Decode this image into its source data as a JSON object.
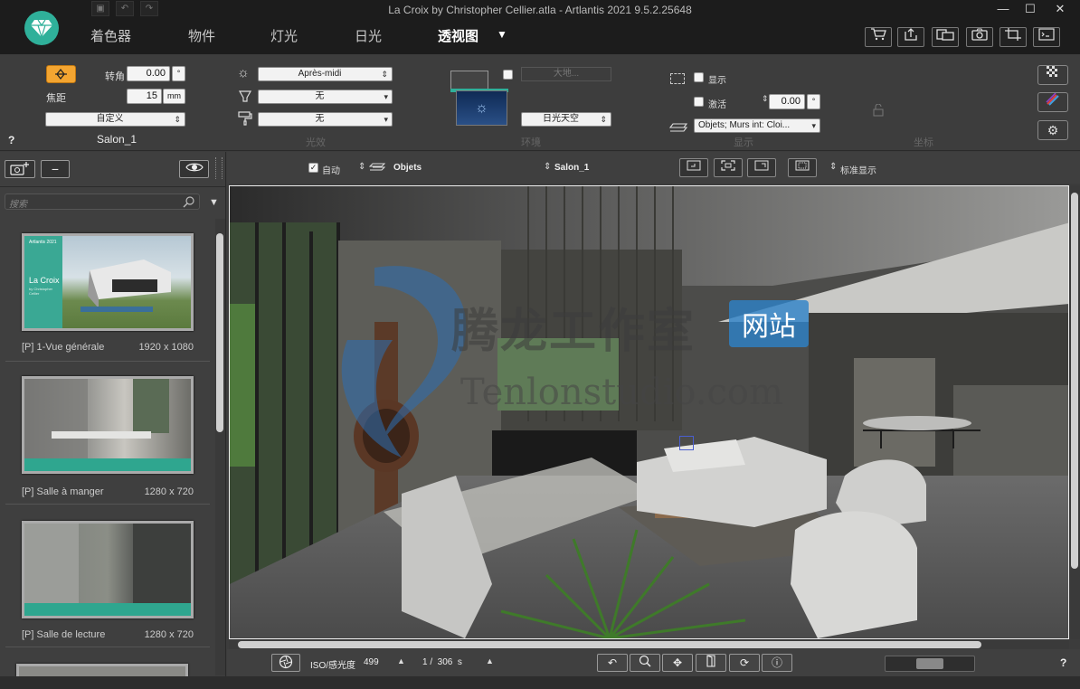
{
  "window": {
    "title": "La Croix by Christopher Cellier.atla - Artlantis 2021 9.5.2.25648",
    "minimize": "—",
    "maximize": "☐",
    "close": "✕"
  },
  "quick_access": {
    "save": "▣",
    "undo": "↶",
    "redo": "↷"
  },
  "nav": {
    "tabs": [
      "着色器",
      "物件",
      "灯光",
      "日光",
      "透视图"
    ],
    "active": "透视图",
    "dropdown_arrow": "▼"
  },
  "top_right_buttons": [
    "shopping-cart",
    "export",
    "window-layout",
    "camera",
    "crop",
    "console"
  ],
  "toolbar": {
    "camera": {
      "rotation_label": "转角",
      "rotation_value": "0.00",
      "rotation_unit": "°",
      "focal_label": "焦距",
      "focal_value": "15",
      "focal_unit": "mm",
      "preset_value": "自定义",
      "view_name": "Salon_1",
      "help": "?"
    },
    "lighting": {
      "heliodon_value": "Après-midi",
      "light_value": "无",
      "paint_value": "无",
      "group_label": "光效"
    },
    "environment": {
      "ground_placeholder": "大地...",
      "sky_value": "日光天空",
      "group_label": "环境"
    },
    "display": {
      "show_label": "显示",
      "activate_label": "激活",
      "angle_value": "0.00",
      "angle_unit": "°",
      "layers_value": "Objets; Murs int: Cloi...",
      "group_label": "显示",
      "coords_label": "坐标"
    }
  },
  "left_panel": {
    "add_button": "+",
    "remove_button": "−",
    "search_placeholder": "搜索",
    "views": [
      {
        "title": "[P]  1-Vue générale",
        "size": "1920 x 1080",
        "thumb_brand": "Artlantis 2021",
        "thumb_title": "La Croix",
        "thumb_sub": "by Christopher Cellier"
      },
      {
        "title": "[P]  Salle à manger",
        "size": "1280 x 720"
      },
      {
        "title": "[P]  Salle de lecture",
        "size": "1280 x 720"
      }
    ]
  },
  "viewport_bar": {
    "auto_label": "自动",
    "objects_value": "Objets",
    "view_value": "Salon_1",
    "display_mode": "标准显示"
  },
  "watermark": {
    "chinese": "腾龙工作室",
    "badge": "网站",
    "latin": "Tenlonstudio.com"
  },
  "bottom_bar": {
    "iso_label": "ISO/感光度",
    "iso_value": "499",
    "shutter_value": "1 /  306  s",
    "help": "?"
  },
  "colors": {
    "accent": "#2fb09a",
    "chrome": "#1c1c1c",
    "panel": "#3d3d3d"
  }
}
